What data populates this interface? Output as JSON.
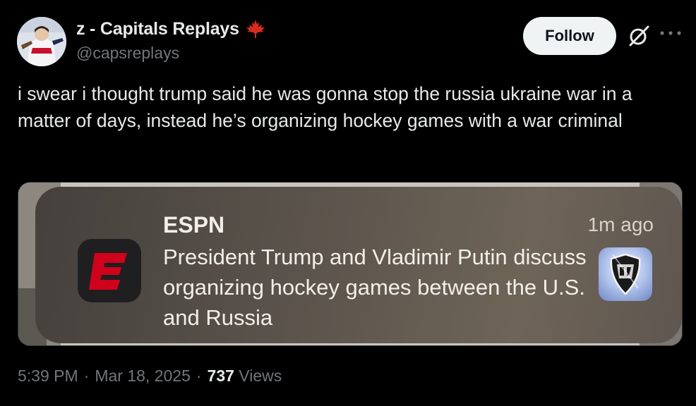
{
  "author": {
    "display_name": "z - Capitals Replays",
    "handle": "@capsreplays",
    "flag_icon": "maple-leaf-icon"
  },
  "actions": {
    "follow_label": "Follow",
    "grok_icon": "grok-icon",
    "more_icon": "more-icon"
  },
  "tweet": {
    "text": "i swear i thought trump said he was gonna stop the russia ukraine war in a matter of days, instead he’s organizing hockey games with a war criminal"
  },
  "notification": {
    "app_name": "ESPN",
    "time": "1m ago",
    "body": "President Trump and Vladimir Putin discuss organizing hockey games between the U.S. and Russia",
    "app_icon": "espn-icon",
    "thumbnail": "nhl-logo"
  },
  "meta": {
    "time": "5:39 PM",
    "separator1": "·",
    "date": "Mar 18, 2025",
    "separator2": "·",
    "views_count": "737",
    "views_label": "Views"
  },
  "colors": {
    "background": "#000000",
    "text": "#e7e9ea",
    "muted": "#71767b",
    "follow_bg": "#eff3f4",
    "espn_red": "#d0021b",
    "maple_red": "#d52b1e"
  }
}
